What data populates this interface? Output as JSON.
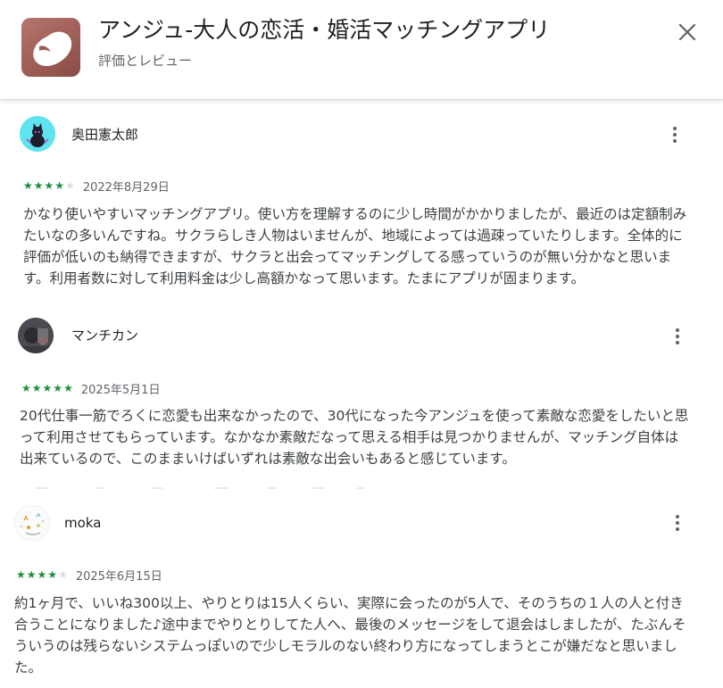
{
  "header": {
    "app_title": "アンジュ-大人の恋活・婚活マッチングアプリ",
    "subtitle": "評価とレビュー",
    "close_icon": "close-icon"
  },
  "colors": {
    "star_on": "#1e8e3e",
    "star_off": "#dadce0",
    "app_icon": "#a0605a"
  },
  "reviews": [
    {
      "name": "奥田憲太郎",
      "rating": 4,
      "max_rating": 5,
      "date": "2022年8月29日",
      "text": "かなり使いやすいマッチングアプリ。使い方を理解するのに少し時間がかかりましたが、最近のは定額制みたいなの多いんですね。サクラらしき人物はいませんが、地域によっては過疎っていたりします。全体的に評価が低いのも納得できますが、サクラと出会ってマッチングしてる感っていうのが無い分かなと思います。利用者数に対して利用料金は少し高額かなって思います。たまにアプリが固まります。",
      "avatar_icon": "cat-avatar-icon"
    },
    {
      "name": "マンチカン",
      "rating": 5,
      "max_rating": 5,
      "date": "2025年5月1日",
      "text": "20代仕事一筋でろくに恋愛も出来なかったので、30代になった今アンジュを使って素敵な恋愛をしたいと思って利用させてもらっています。なかなか素敵だなって思える相手は見つかりませんが、マッチング自体は出来ているので、このままいけばいずれは素敵な出会いもあると感じています。",
      "avatar_icon": "photo-avatar-icon"
    },
    {
      "name": "moka",
      "rating": 4,
      "max_rating": 5,
      "date": "2025年6月15日",
      "text": "約1ヶ月で、いいね300以上、やりとりは15人くらい、実際に会ったのが5人で、そのうちの１人の人と付き合うことになりました♪途中までやりとりしてた人へ、最後のメッセージをして退会はしましたが、たぶんそういうのは残らないシステムっぽいので少しモラルのない終わり方になってしまうとこが嫌だなと思いました。",
      "avatar_icon": "doodle-avatar-icon"
    }
  ]
}
